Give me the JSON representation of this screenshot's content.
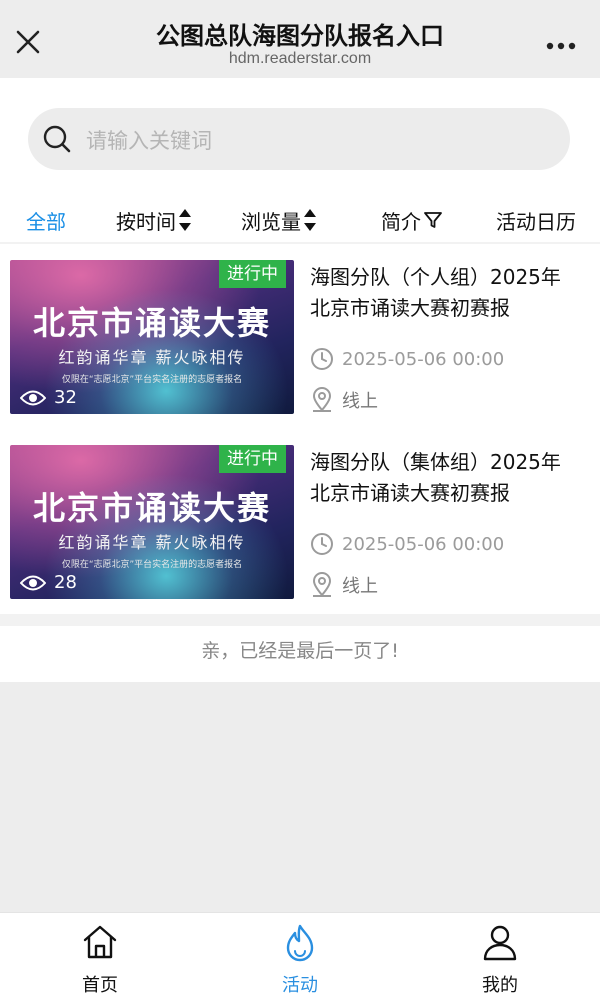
{
  "header": {
    "title": "公图总队海图分队报名入口",
    "subtitle": "hdm.readerstar.com",
    "close_icon": "close-icon",
    "more_icon": "more-dots-icon"
  },
  "search": {
    "placeholder": "请输入关键词",
    "icon": "search-icon"
  },
  "filters": {
    "all": "全部",
    "by_time": "按时间",
    "views": "浏览量",
    "intro": "简介",
    "calendar": "活动日历"
  },
  "activities": [
    {
      "badge": "进行中",
      "poster_title": "北京市诵读大赛",
      "poster_subtitle": "红韵诵华章  薪火咏相传",
      "poster_note": "仅限在“志愿北京”平台实名注册的志愿者报名",
      "views": "32",
      "title": "海图分队（个人组）2025年北京市诵读大赛初赛报",
      "time": "2025-05-06 00:00",
      "location": "线上"
    },
    {
      "badge": "进行中",
      "poster_title": "北京市诵读大赛",
      "poster_subtitle": "红韵诵华章  薪火咏相传",
      "poster_note": "仅限在“志愿北京”平台实名注册的志愿者报名",
      "views": "28",
      "title": "海图分队（集体组）2025年北京市诵读大赛初赛报",
      "time": "2025-05-06 00:00",
      "location": "线上"
    }
  ],
  "end_note": "亲，已经是最后一页了!",
  "bottom_nav": {
    "home": "首页",
    "activity": "活动",
    "mine": "我的"
  },
  "colors": {
    "accent": "#1a8fe6",
    "badge": "#2fb34a",
    "background": "#ededed"
  }
}
